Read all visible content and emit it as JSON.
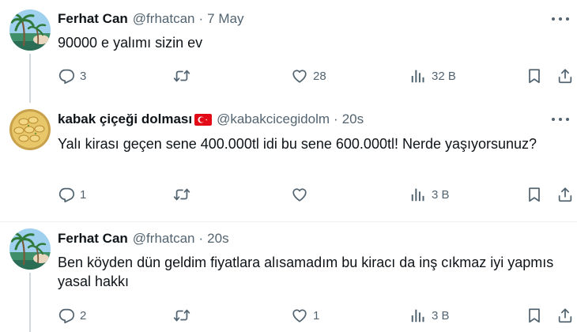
{
  "tweets": [
    {
      "name": "Ferhat Can",
      "handle": "@frhatcan",
      "time": "7 May",
      "text": "90000 e yalımı sizin ev",
      "replies": "3",
      "retweets": "",
      "likes": "28",
      "views": "32 B",
      "avatar": "palm-avatar"
    },
    {
      "name": "kabak çiçeği dolması",
      "flag": "turkey-flag",
      "handle": "@kabakcicegidolm",
      "time": "20s",
      "text": "Yalı kirası geçen sene 400.000tl idi bu sene 600.000tl! Nerde yaşıyorsunuz?",
      "replies": "1",
      "retweets": "",
      "likes": "",
      "views": "3 B",
      "avatar": "food-avatar"
    },
    {
      "name": "Ferhat Can",
      "handle": "@frhatcan",
      "time": "20s",
      "text": "Ben köyden dün geldim fiyatlara alısamadım bu kiracı da inş cıkmaz iyi yapmıs yasal hakkı",
      "replies": "2",
      "retweets": "",
      "likes": "1",
      "views": "3 B",
      "avatar": "palm-avatar"
    }
  ],
  "colors": {
    "text": "#0f1419",
    "secondary": "#536471",
    "thread_line": "#cfd9de",
    "flag_red": "#e30a17"
  },
  "icons": [
    "reply-icon",
    "retweet-icon",
    "like-icon",
    "views-icon",
    "bookmark-icon",
    "share-icon",
    "more-icon"
  ]
}
